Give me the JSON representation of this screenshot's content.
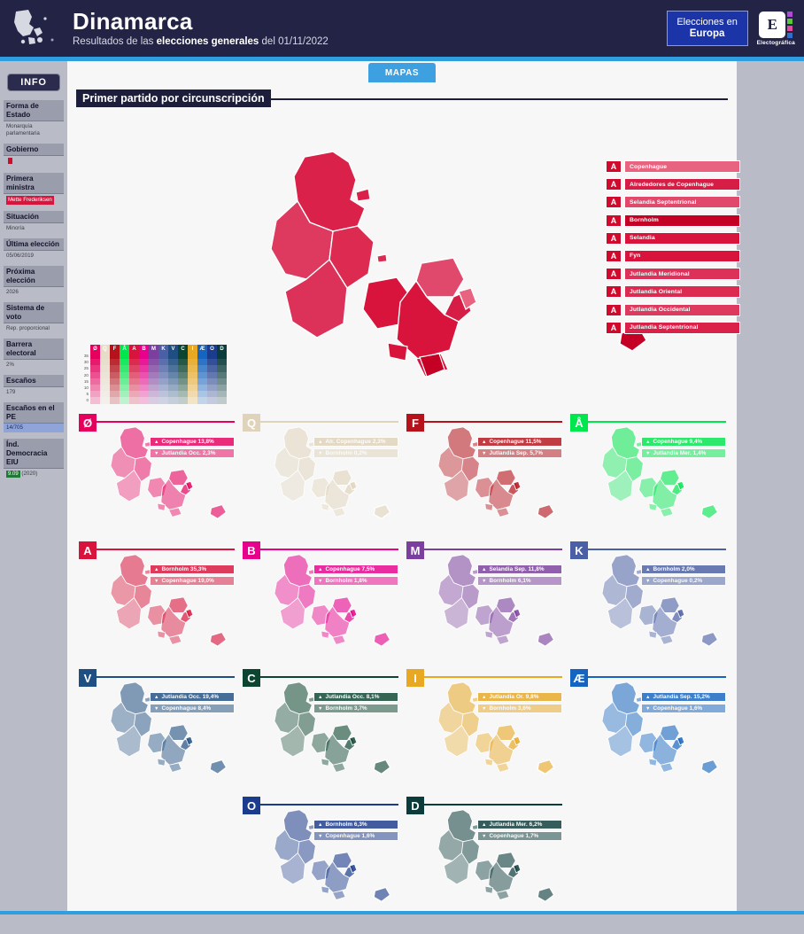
{
  "header": {
    "title": "Dinamarca",
    "subtitle_prefix": "Resultados de las ",
    "subtitle_bold": "elecciones generales",
    "subtitle_suffix": " del 01/11/2022",
    "eu_button_line1": "Elecciones en",
    "eu_button_line2": "Europa",
    "logo_letter": "E",
    "logo_caption": "Electográfica",
    "flag_icon": "denmark-map-icon"
  },
  "sidebar": {
    "info_label": "INFO",
    "items": [
      {
        "label": "Forma de Estado",
        "value": "Monarquía parlamentaria",
        "style": "plain"
      },
      {
        "label": "Gobierno",
        "value": "A",
        "style": "flag"
      },
      {
        "label": "Primera ministra",
        "value": "Mette Frederiksen",
        "style": "red"
      },
      {
        "label": "Situación",
        "value": "Minoría",
        "style": "plain"
      },
      {
        "label": "Última elección",
        "value": "05/06/2019",
        "style": "plain"
      },
      {
        "label": "Próxima elección",
        "value": "2026",
        "style": "plain"
      },
      {
        "label": "Sistema de voto",
        "value": "Rep. proporcional",
        "style": "plain"
      },
      {
        "label": "Barrera electoral",
        "value": "2%",
        "style": "plain"
      },
      {
        "label": "Escaños",
        "value": "179",
        "style": "plain"
      },
      {
        "label": "Escaños en el PE",
        "value": "14/705",
        "style": "blue"
      },
      {
        "label": "Índ. Democracia EIU",
        "value": "9.09 (2020)",
        "style": "eiu"
      }
    ]
  },
  "main": {
    "tab_label": "MAPAS",
    "section_title": "Primer partido por circunscripción"
  },
  "legend": {
    "entries": [
      {
        "letter": "A",
        "name": "Copenhague",
        "color": "#e8637f"
      },
      {
        "letter": "A",
        "name": "Alrededores de Copenhague",
        "color": "#d61d45"
      },
      {
        "letter": "A",
        "name": "Selandia Septentrional",
        "color": "#e1496c"
      },
      {
        "letter": "A",
        "name": "Bornholm",
        "color": "#c40025"
      },
      {
        "letter": "A",
        "name": "Selandia",
        "color": "#d8143c"
      },
      {
        "letter": "A",
        "name": "Fyn",
        "color": "#d8143c"
      },
      {
        "letter": "A",
        "name": "Jutlandia Meridional",
        "color": "#dc3159"
      },
      {
        "letter": "A",
        "name": "Jutlandia Oriental",
        "color": "#dd2a51"
      },
      {
        "letter": "A",
        "name": "Jutlandia Occidental",
        "color": "#de3a5f"
      },
      {
        "letter": "A",
        "name": "Jutlandia Septentrional",
        "color": "#da2149"
      }
    ]
  },
  "scale": {
    "axis_ticks": [
      "35",
      "30",
      "25",
      "20",
      "15",
      "10",
      "5",
      "0"
    ],
    "columns": [
      {
        "letter": "Ø",
        "color": "#e6005e"
      },
      {
        "letter": "Q",
        "color": "#e6dcc8"
      },
      {
        "letter": "F",
        "color": "#b5121b"
      },
      {
        "letter": "Å",
        "color": "#00e64d"
      },
      {
        "letter": "A",
        "color": "#d8143c"
      },
      {
        "letter": "B",
        "color": "#e6008c"
      },
      {
        "letter": "M",
        "color": "#7b3f9e"
      },
      {
        "letter": "K",
        "color": "#4a5fa5"
      },
      {
        "letter": "V",
        "color": "#1f4f82"
      },
      {
        "letter": "C",
        "color": "#0d4630"
      },
      {
        "letter": "I",
        "color": "#e8a823"
      },
      {
        "letter": "Æ",
        "color": "#1565c0"
      },
      {
        "letter": "O",
        "color": "#1b3b8c"
      },
      {
        "letter": "D",
        "color": "#0c3b3b"
      }
    ]
  },
  "parties": [
    {
      "letter": "Ø",
      "color": "#e6005e",
      "top": {
        "region": "Copenhague",
        "value": "13,8%"
      },
      "bottom": {
        "region": "Jutlandia Occ.",
        "value": "2,3%"
      }
    },
    {
      "letter": "Q",
      "color": "#e0d3bb",
      "top": {
        "region": "Alr. Copenhague",
        "value": "2,3%"
      },
      "bottom": {
        "region": "Bornholm",
        "value": "0,2%"
      }
    },
    {
      "letter": "F",
      "color": "#b5121b",
      "top": {
        "region": "Copenhague",
        "value": "11,5%"
      },
      "bottom": {
        "region": "Jutlandia Sep.",
        "value": "5,7%"
      }
    },
    {
      "letter": "Å",
      "color": "#00e64d",
      "top": {
        "region": "Copenhague",
        "value": "9,4%"
      },
      "bottom": {
        "region": "Jutlandia Mer.",
        "value": "1,4%"
      }
    },
    {
      "letter": "A",
      "color": "#d8143c",
      "top": {
        "region": "Bornholm",
        "value": "35,3%"
      },
      "bottom": {
        "region": "Copenhague",
        "value": "19,0%"
      }
    },
    {
      "letter": "B",
      "color": "#e6008c",
      "top": {
        "region": "Copenhague",
        "value": "7,5%"
      },
      "bottom": {
        "region": "Bornholm",
        "value": "1,8%"
      }
    },
    {
      "letter": "M",
      "color": "#7b3f9e",
      "top": {
        "region": "Selandia Sep.",
        "value": "11,8%"
      },
      "bottom": {
        "region": "Bornholm",
        "value": "6,1%"
      }
    },
    {
      "letter": "K",
      "color": "#4a5fa5",
      "top": {
        "region": "Bornholm",
        "value": "2,0%"
      },
      "bottom": {
        "region": "Copenhague",
        "value": "0,2%"
      }
    },
    {
      "letter": "V",
      "color": "#1f4f82",
      "top": {
        "region": "Jutlandia Occ.",
        "value": "19,4%"
      },
      "bottom": {
        "region": "Copenhague",
        "value": "8,4%"
      }
    },
    {
      "letter": "C",
      "color": "#0d4630",
      "top": {
        "region": "Jutlandia Occ.",
        "value": "8,1%"
      },
      "bottom": {
        "region": "Bornholm",
        "value": "3,7%"
      }
    },
    {
      "letter": "I",
      "color": "#e8a823",
      "top": {
        "region": "Jutlandia Or.",
        "value": "9,8%"
      },
      "bottom": {
        "region": "Bornholm",
        "value": "3,6%"
      }
    },
    {
      "letter": "Æ",
      "color": "#1565c0",
      "top": {
        "region": "Jutlandia Sep.",
        "value": "15,2%"
      },
      "bottom": {
        "region": "Copenhague",
        "value": "1,6%"
      }
    },
    {
      "letter": "O",
      "color": "#1b3b8c",
      "top": {
        "region": "Bornholm",
        "value": "6,3%"
      },
      "bottom": {
        "region": "Copenhague",
        "value": "1,6%"
      }
    },
    {
      "letter": "D",
      "color": "#0c3b3b",
      "top": {
        "region": "Jutlandia Mer.",
        "value": "6,2%"
      },
      "bottom": {
        "region": "Copenhague",
        "value": "1,7%"
      }
    }
  ],
  "icons": {
    "up_triangle": "▲",
    "down_triangle": "▼"
  }
}
